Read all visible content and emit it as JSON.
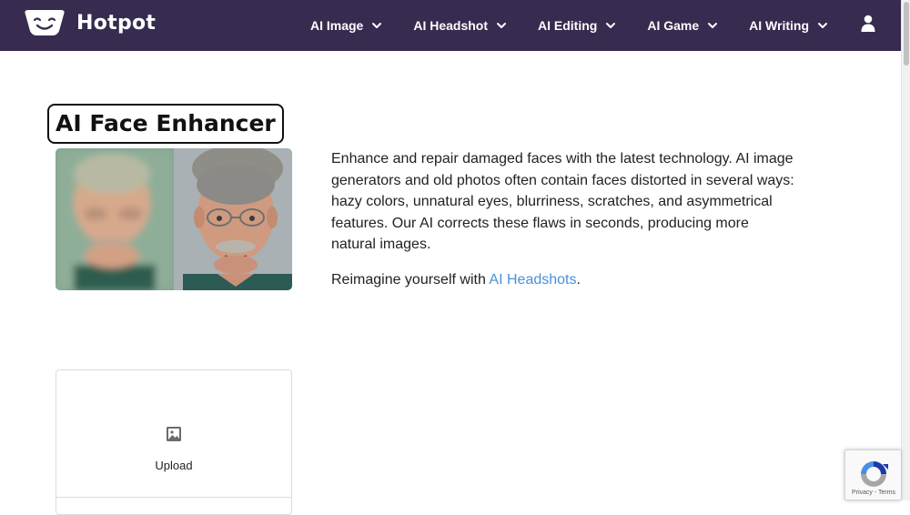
{
  "brand": {
    "name": "Hotpot"
  },
  "nav": {
    "items": [
      {
        "label": "AI Image"
      },
      {
        "label": "AI Headshot"
      },
      {
        "label": "AI Editing"
      },
      {
        "label": "AI Game"
      },
      {
        "label": "AI Writing"
      }
    ]
  },
  "page": {
    "title": "AI Face Enhancer",
    "description": "Enhance and repair damaged faces with the latest technology. AI image generators and old photos often contain faces distorted in several ways: hazy colors, unnatural eyes, blurriness, scratches, and asymmetrical features. Our AI corrects these flaws in seconds, producing more natural images.",
    "reimagine_prefix": "Reimagine yourself with ",
    "reimagine_link": "AI Headshots",
    "reimagine_suffix": "."
  },
  "upload": {
    "label": "Upload"
  },
  "recaptcha": {
    "footer": "Privacy - Terms"
  },
  "colors": {
    "navbar": "#372b4f",
    "link": "#4a90d9",
    "background": "#ffffff"
  }
}
